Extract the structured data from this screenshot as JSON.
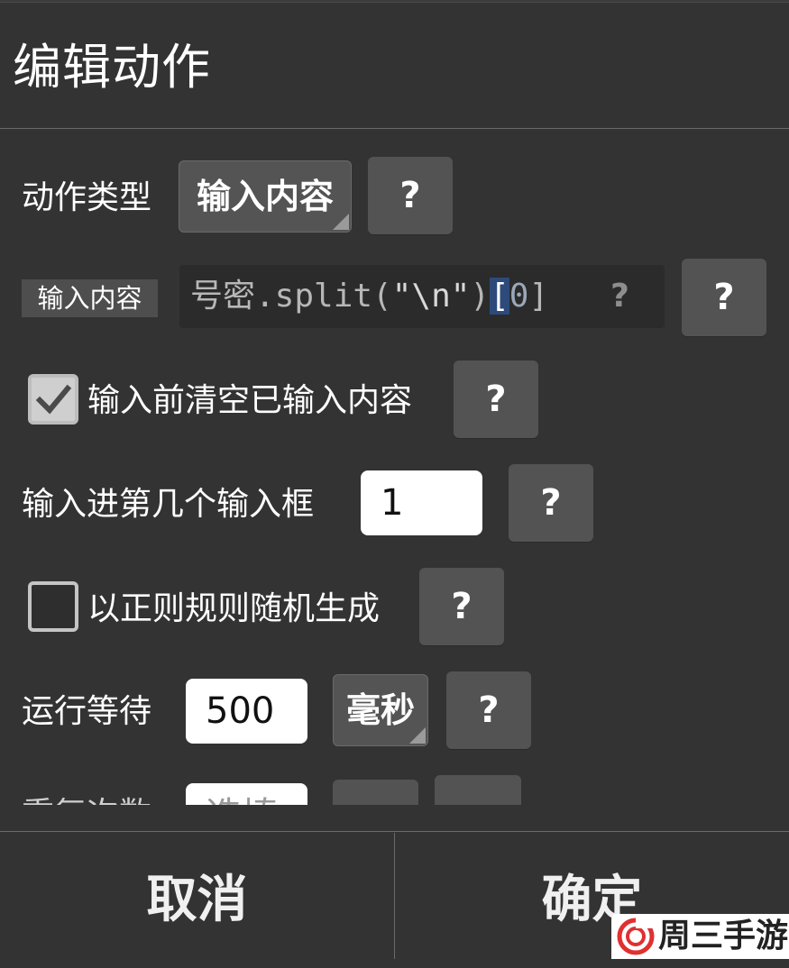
{
  "dialog": {
    "title": "编辑动作"
  },
  "action_type": {
    "label": "动作类型",
    "value": "输入内容",
    "help": "?"
  },
  "input_content": {
    "tag_label": "输入内容",
    "code_prefix": "号密.split(",
    "code_string": "\"\\n\"",
    "code_close": ")",
    "code_bracket_open": "[",
    "code_index": "0",
    "code_bracket_close": "]",
    "inline_help": "?",
    "help": "?"
  },
  "clear_before_input": {
    "label": "输入前清空已输入内容",
    "checked": true,
    "help": "?"
  },
  "input_box_index": {
    "label": "输入进第几个输入框",
    "value": "1",
    "help": "?"
  },
  "regex_random": {
    "label": "以正则规则随机生成",
    "checked": false,
    "help": "?"
  },
  "run_wait": {
    "label": "运行等待",
    "value": "500",
    "unit": "毫秒",
    "help": "?"
  },
  "next_row": {
    "label": "重复次数",
    "value": "选填"
  },
  "footer": {
    "cancel_label": "取消",
    "confirm_label": "确定"
  },
  "watermark": {
    "text": "周三手游网"
  },
  "colors": {
    "background": "#333333",
    "button": "#535353",
    "code_text": "#b7b7b7",
    "code_string": "#d8d8d8",
    "code_number": "#9aa8b8",
    "cursor_highlight": "#2d4a7a"
  }
}
